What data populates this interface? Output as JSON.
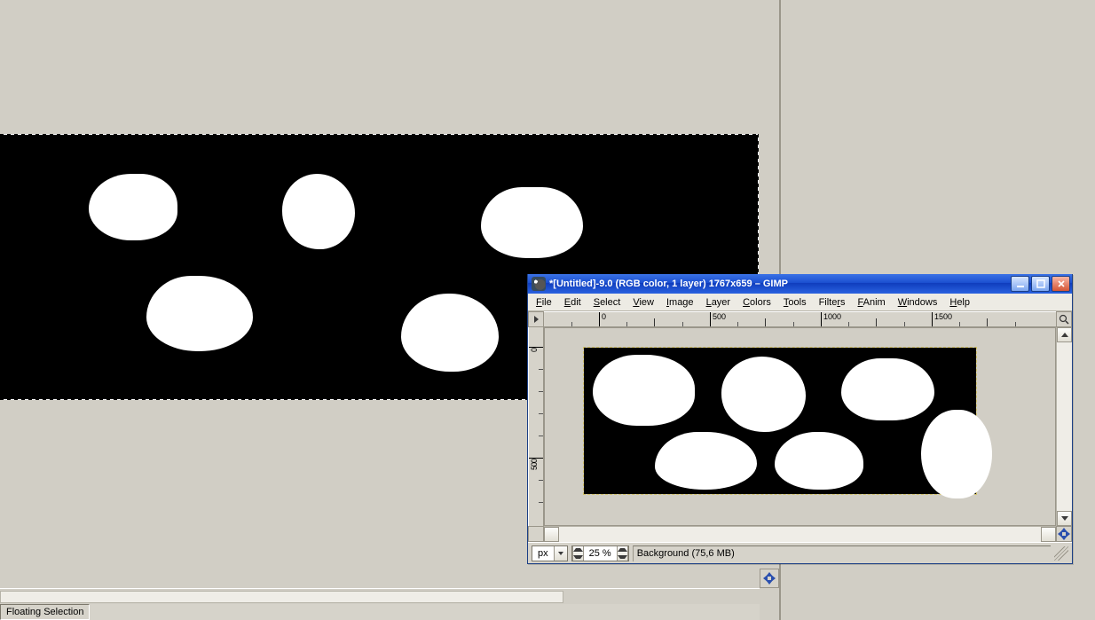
{
  "main": {
    "status_label": "Floating Selection"
  },
  "win2": {
    "title": "*[Untitled]-9.0 (RGB color, 1 layer) 1767x659 – GIMP",
    "menu": [
      "File",
      "Edit",
      "Select",
      "View",
      "Image",
      "Layer",
      "Colors",
      "Tools",
      "Filters",
      "FAnim",
      "Windows",
      "Help"
    ],
    "ruler_h": [
      "0",
      "500",
      "1000",
      "1500"
    ],
    "ruler_v": [
      "0",
      "500"
    ],
    "units_value": "px",
    "zoom_value": "25 %",
    "status_msg": "Background (75,6 MB)"
  }
}
